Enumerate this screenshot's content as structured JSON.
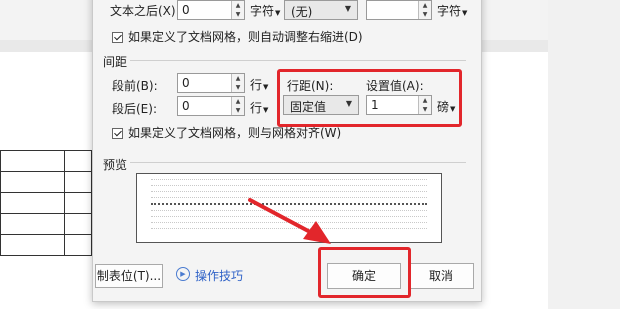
{
  "indent": {
    "after_label": "文本之后(X):",
    "after_value": "0",
    "after_unit": "字符",
    "special_value": "(无)",
    "by_unit": "字符",
    "auto_adjust_checkbox": "如果定义了文档网格，则自动调整右缩进(D)"
  },
  "spacing": {
    "section_label": "间距",
    "before_label": "段前(B):",
    "before_value": "0",
    "before_unit": "行",
    "after_label": "段后(E):",
    "after_value": "0",
    "after_unit": "行",
    "line_spacing_label": "行距(N):",
    "line_spacing_value": "固定值",
    "set_value_label": "设置值(A):",
    "set_value": "1",
    "set_value_unit": "磅",
    "snap_grid_checkbox": "如果定义了文档网格，则与网格对齐(W)"
  },
  "preview": {
    "section_label": "预览"
  },
  "footer": {
    "tabs_button": "制表位(T)...",
    "tips_link": "操作技巧",
    "ok_button": "确定",
    "cancel_button": "取消"
  },
  "colors": {
    "highlight": "#e2262b",
    "link": "#2f62c7"
  }
}
